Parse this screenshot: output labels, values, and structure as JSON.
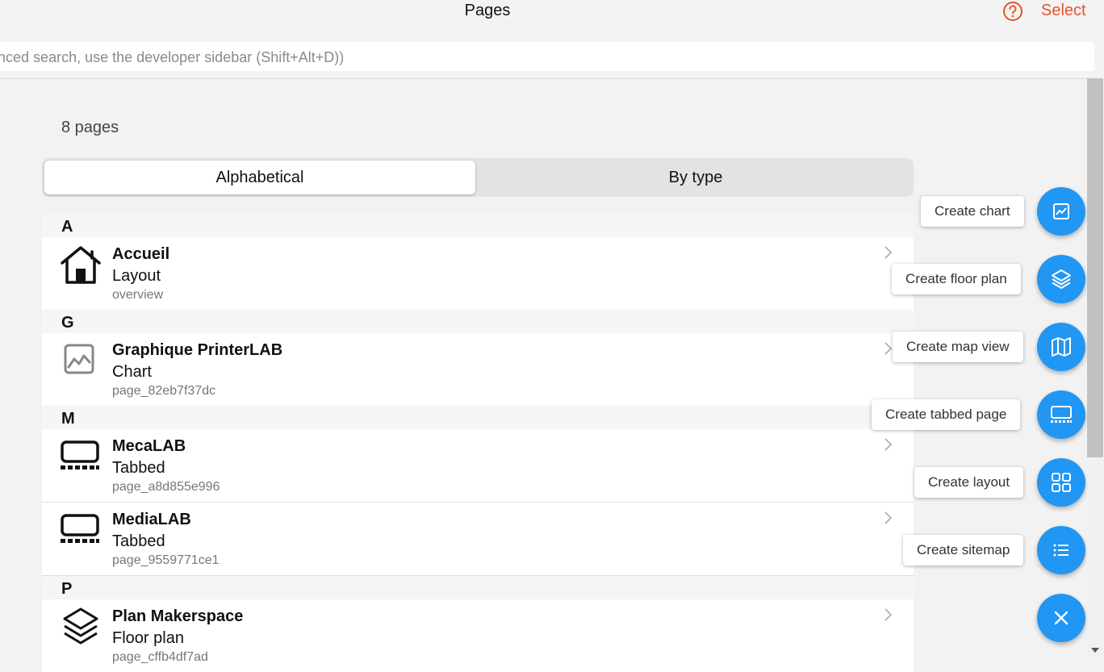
{
  "header": {
    "title": "Pages",
    "select_label": "Select",
    "help_icon": "help-circle-icon"
  },
  "search": {
    "placeholder": "dvanced search, use the developer sidebar (Shift+Alt+D))"
  },
  "summary": {
    "count_text": "8 pages"
  },
  "view_toggle": {
    "tabs": [
      {
        "label": "Alphabetical",
        "active": true
      },
      {
        "label": "By type",
        "active": false
      }
    ]
  },
  "list": {
    "groups": [
      {
        "letter": "A",
        "items": [
          {
            "name": "Accueil",
            "type": "Layout",
            "id": "overview",
            "icon": "home-icon"
          }
        ]
      },
      {
        "letter": "G",
        "items": [
          {
            "name": "Graphique PrinterLAB",
            "type": "Chart",
            "id": "page_82eb7f37dc",
            "icon": "chart-icon"
          }
        ]
      },
      {
        "letter": "M",
        "items": [
          {
            "name": "MecaLAB",
            "type": "Tabbed",
            "id": "page_a8d855e996",
            "icon": "tabbed-icon"
          },
          {
            "name": "MediaLAB",
            "type": "Tabbed",
            "id": "page_9559771ce1",
            "icon": "tabbed-icon"
          }
        ]
      },
      {
        "letter": "P",
        "items": [
          {
            "name": "Plan Makerspace",
            "type": "Floor plan",
            "id": "page_cffb4df7ad",
            "icon": "layers-icon"
          }
        ]
      }
    ]
  },
  "fab_menu": {
    "actions": [
      {
        "label": "Create chart",
        "icon": "chart-icon"
      },
      {
        "label": "Create floor plan",
        "icon": "layers-icon"
      },
      {
        "label": "Create map view",
        "icon": "map-icon"
      },
      {
        "label": "Create tabbed page",
        "icon": "tabbed-icon"
      },
      {
        "label": "Create layout",
        "icon": "grid-icon"
      },
      {
        "label": "Create sitemap",
        "icon": "list-icon"
      }
    ],
    "close_icon": "close-icon"
  },
  "colors": {
    "accent": "#e0552b",
    "fab": "#2196f3",
    "background": "#f2f2f2"
  }
}
